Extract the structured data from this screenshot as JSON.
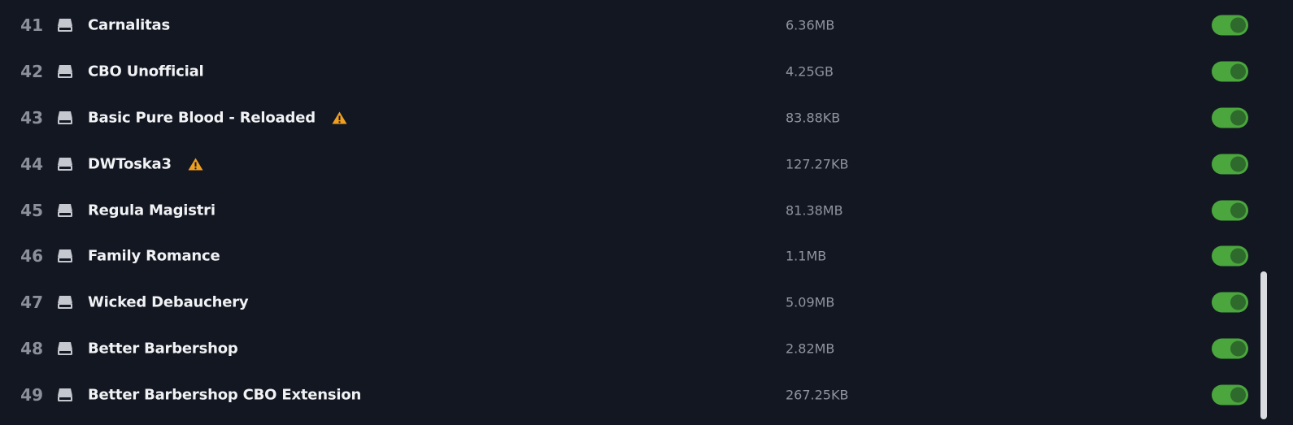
{
  "mods": [
    {
      "index": "41",
      "name": "Carnalitas",
      "size": "6.36MB",
      "warning": false,
      "enabled": true
    },
    {
      "index": "42",
      "name": "CBO Unofficial",
      "size": "4.25GB",
      "warning": false,
      "enabled": true
    },
    {
      "index": "43",
      "name": "Basic Pure Blood - Reloaded",
      "size": "83.88KB",
      "warning": true,
      "enabled": true
    },
    {
      "index": "44",
      "name": "DWToska3",
      "size": "127.27KB",
      "warning": true,
      "enabled": true
    },
    {
      "index": "45",
      "name": "Regula Magistri",
      "size": "81.38MB",
      "warning": false,
      "enabled": true
    },
    {
      "index": "46",
      "name": "Family Romance",
      "size": "1.1MB",
      "warning": false,
      "enabled": true
    },
    {
      "index": "47",
      "name": "Wicked Debauchery",
      "size": "5.09MB",
      "warning": false,
      "enabled": true
    },
    {
      "index": "48",
      "name": "Better Barbershop",
      "size": "2.82MB",
      "warning": false,
      "enabled": true
    },
    {
      "index": "49",
      "name": "Better Barbershop CBO Extension",
      "size": "267.25KB",
      "warning": false,
      "enabled": true
    }
  ],
  "icons": {
    "row_icon": "drive-icon",
    "warning_icon": "warning-icon",
    "toggle_icon": "toggle-switch"
  },
  "colors": {
    "background": "#131722",
    "text_primary": "#f1f2f4",
    "text_muted": "#8f949e",
    "toggle_on": "#4aa63d",
    "toggle_knob": "#2d6a2b",
    "warning": "#f0a020",
    "scrollbar_thumb": "#d9dbe0"
  }
}
